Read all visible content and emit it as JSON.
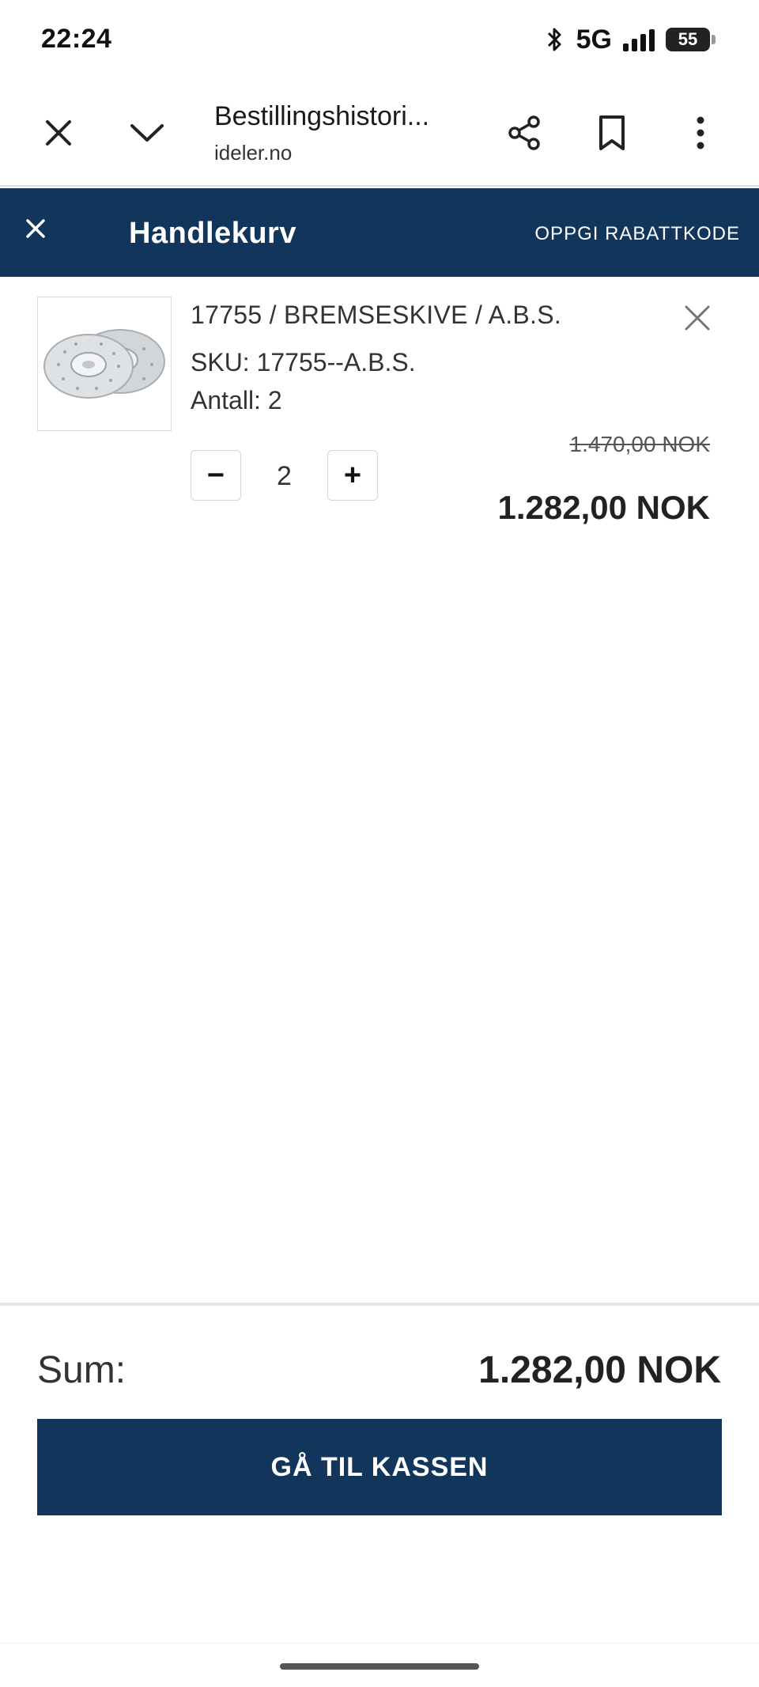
{
  "status_bar": {
    "time": "22:24",
    "network": "5G",
    "battery": "55",
    "icons": [
      "bluetooth-icon",
      "signal-icon",
      "battery-icon"
    ]
  },
  "browser": {
    "page_title": "Bestillingshistori...",
    "url": "ideler.no",
    "icons": [
      "close-icon",
      "chevron-down-icon",
      "share-icon",
      "bookmark-icon",
      "more-vert-icon"
    ]
  },
  "cart": {
    "title": "Handlekurv",
    "discount_link": "OPPGI RABATTKODE",
    "items": [
      {
        "name": "17755 / BREMSESKIVE / A.B.S.",
        "sku": "SKU: 17755--A.B.S.",
        "quantity_text": "Antall: 2",
        "quantity": "2",
        "minus_label": "−",
        "plus_label": "+",
        "price_original": "1.470,00 NOK",
        "price_current": "1.282,00 NOK"
      }
    ]
  },
  "summary": {
    "sum_label": "Sum:",
    "sum_value": "1.282,00 NOK",
    "checkout_label": "GÅ TIL KASSEN"
  },
  "colors": {
    "primary": "#12355b",
    "background": "#ffffff"
  }
}
